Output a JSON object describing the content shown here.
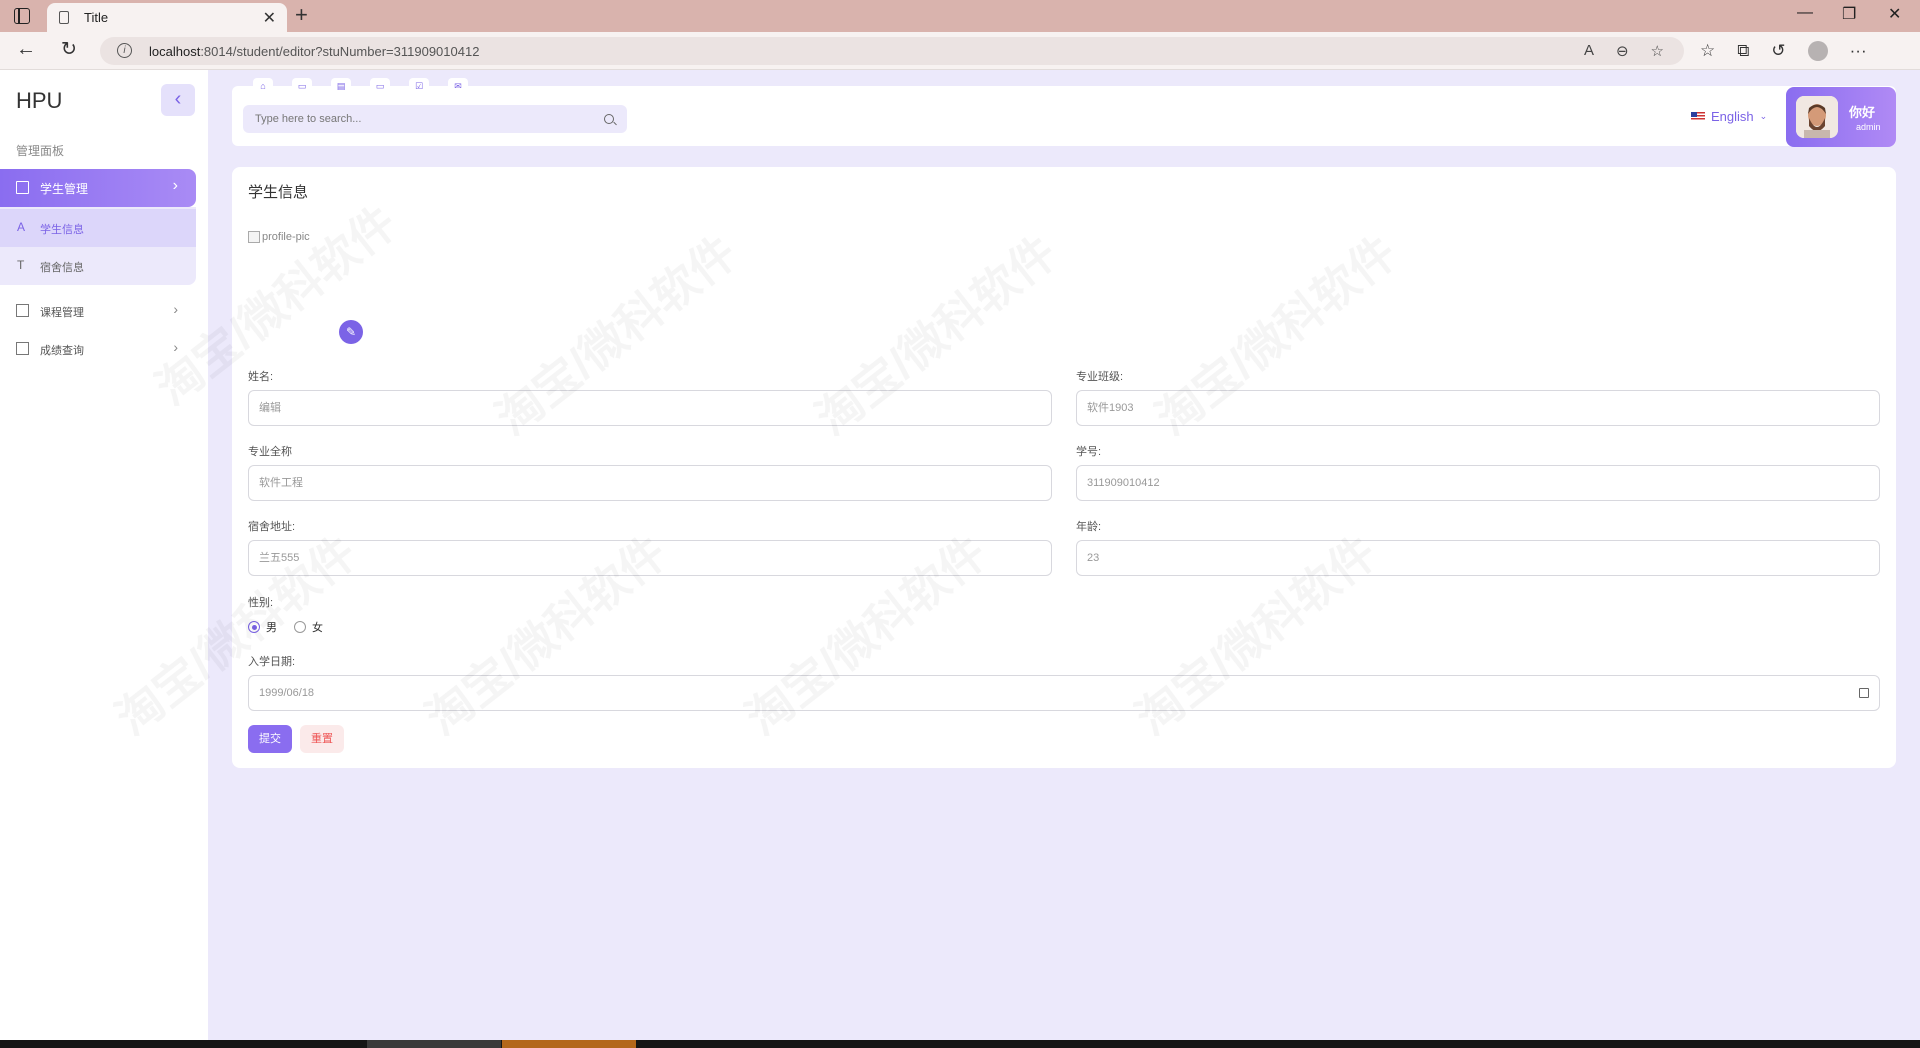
{
  "browser": {
    "tab_title": "Title",
    "url_host": "localhost",
    "url_rest": ":8014/student/editor?stuNumber=311909010412"
  },
  "sidebar": {
    "brand": "HPU",
    "section_heading": "管理面板",
    "active_menu": "学生管理",
    "sub_items": [
      {
        "label": "学生信息",
        "icon": "A"
      },
      {
        "label": "宿舍信息",
        "icon": "T"
      }
    ],
    "menu_items": [
      {
        "label": "课程管理"
      },
      {
        "label": "成绩查询"
      }
    ]
  },
  "header": {
    "search_placeholder": "Type here to search...",
    "language": "English",
    "greeting": "你好",
    "username": "admin"
  },
  "form": {
    "title": "学生信息",
    "profile_pic_alt": "profile-pic",
    "name_label": "姓名:",
    "name_value": "编辑",
    "class_label": "专业班级:",
    "class_value": "软件1903",
    "major_label": "专业全称",
    "major_value": "软件工程",
    "number_label": "学号:",
    "number_value": "311909010412",
    "dorm_label": "宿舍地址:",
    "dorm_value": "兰五555",
    "age_label": "年龄:",
    "age_value": "23",
    "gender_label": "性别:",
    "gender_options": [
      "男",
      "女"
    ],
    "gender_selected": "男",
    "date_label": "入学日期:",
    "date_value": "1999/06/18",
    "submit_label": "提交",
    "reset_label": "重置"
  },
  "watermark": "淘宝/微科软件",
  "colors": {
    "accent": "#8a6df0",
    "background": "#ece9fb",
    "reset": "#e55555"
  }
}
